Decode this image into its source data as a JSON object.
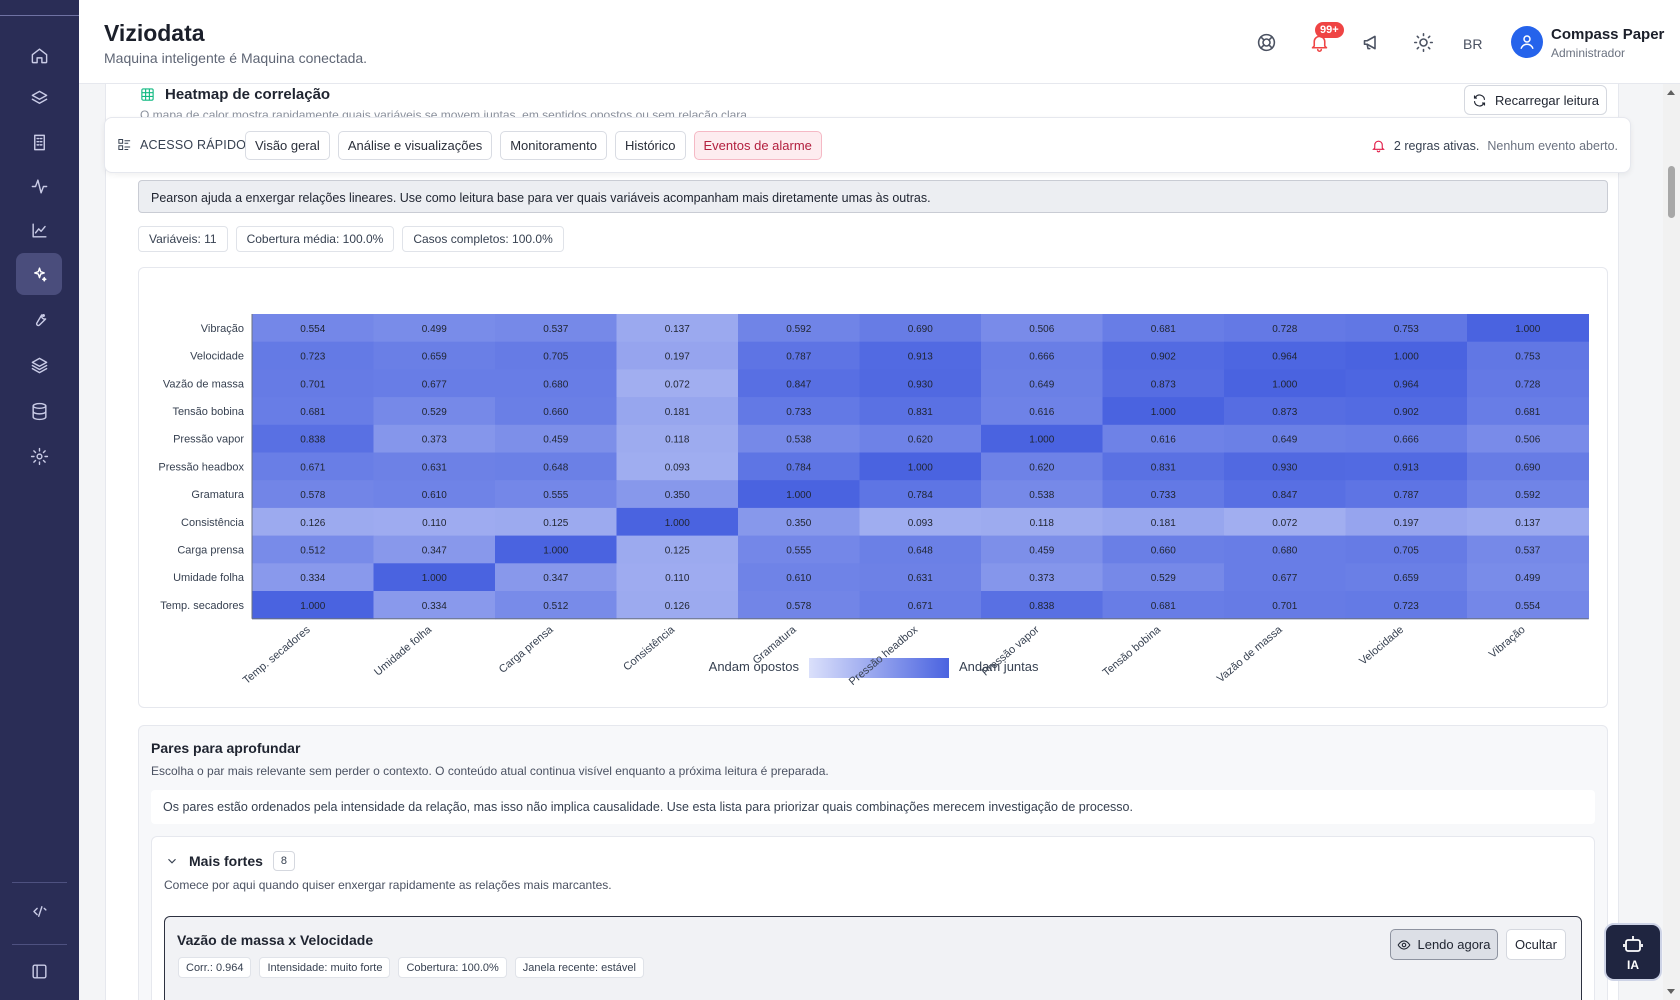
{
  "app": {
    "title": "Viziodata",
    "subtitle": "Maquina inteligente é Maquina conectada."
  },
  "header": {
    "notifications_badge": "99+",
    "language": "BR",
    "user_name": "Compass Paper",
    "user_role": "Administrador"
  },
  "sidebar": {
    "items": [
      "home-icon",
      "layers-icon",
      "building-icon",
      "activity-icon",
      "trend-chart-icon",
      "sparkles-icon",
      "wrench-icon",
      "stack-icon",
      "database-icon",
      "gear-icon"
    ],
    "active_index": 5
  },
  "section": {
    "title": "Heatmap de correlação",
    "description": "O mapa de calor mostra rapidamente quais variáveis se movem juntas, em sentidos opostos ou sem relação clara.",
    "reload_label": "Recarregar leitura"
  },
  "quick_access": {
    "label": "ACESSO RÁPIDO",
    "tabs": [
      "Visão geral",
      "Análise e visualizações",
      "Monitoramento",
      "Histórico",
      "Eventos de alarme"
    ],
    "status_active": "2 regras ativas.",
    "status_events": "Nenhum evento aberto."
  },
  "info_text": "Pearson ajuda a enxergar relações lineares. Use como leitura base para ver quais variáveis acompanham mais diretamente umas às outras.",
  "stats": {
    "variables": "Variáveis: 11",
    "coverage": "Cobertura média: 100.0%",
    "complete": "Casos completos: 100.0%"
  },
  "chart_data": {
    "type": "heatmap",
    "x_labels": [
      "Temp. secadores",
      "Umidade folha",
      "Carga prensa",
      "Consistência",
      "Gramatura",
      "Pressão headbox",
      "Pressão vapor",
      "Tensão bobina",
      "Vazão de massa",
      "Velocidade",
      "Vibração"
    ],
    "y_labels": [
      "Vibração",
      "Velocidade",
      "Vazão de massa",
      "Tensão bobina",
      "Pressão vapor",
      "Pressão headbox",
      "Gramatura",
      "Consistência",
      "Carga prensa",
      "Umidade folha",
      "Temp. secadores"
    ],
    "values": [
      [
        0.554,
        0.499,
        0.537,
        0.137,
        0.592,
        0.69,
        0.506,
        0.681,
        0.728,
        0.753,
        1.0
      ],
      [
        0.723,
        0.659,
        0.705,
        0.197,
        0.787,
        0.913,
        0.666,
        0.902,
        0.964,
        1.0,
        0.753
      ],
      [
        0.701,
        0.677,
        0.68,
        0.072,
        0.847,
        0.93,
        0.649,
        0.873,
        1.0,
        0.964,
        0.728
      ],
      [
        0.681,
        0.529,
        0.66,
        0.181,
        0.733,
        0.831,
        0.616,
        1.0,
        0.873,
        0.902,
        0.681
      ],
      [
        0.838,
        0.373,
        0.459,
        0.118,
        0.538,
        0.62,
        1.0,
        0.616,
        0.649,
        0.666,
        0.506
      ],
      [
        0.671,
        0.631,
        0.648,
        0.093,
        0.784,
        1.0,
        0.62,
        0.831,
        0.93,
        0.913,
        0.69
      ],
      [
        0.578,
        0.61,
        0.555,
        0.35,
        1.0,
        0.784,
        0.538,
        0.733,
        0.847,
        0.787,
        0.592
      ],
      [
        0.126,
        0.11,
        0.125,
        1.0,
        0.35,
        0.093,
        0.118,
        0.181,
        0.072,
        0.197,
        0.137
      ],
      [
        0.512,
        0.347,
        1.0,
        0.125,
        0.555,
        0.648,
        0.459,
        0.66,
        0.68,
        0.705,
        0.537
      ],
      [
        0.334,
        1.0,
        0.347,
        0.11,
        0.61,
        0.631,
        0.373,
        0.529,
        0.677,
        0.659,
        0.499
      ],
      [
        1.0,
        0.334,
        0.512,
        0.126,
        0.578,
        0.671,
        0.838,
        0.681,
        0.701,
        0.723,
        0.554
      ]
    ],
    "color_range": [
      "#dbe0fb",
      "#4a63e0"
    ],
    "legend_low": "Andam opostos",
    "legend_high": "Andam juntas"
  },
  "pairs": {
    "title": "Pares para aprofundar",
    "description": "Escolha o par mais relevante sem perder o contexto. O conteúdo atual continua visível enquanto a próxima leitura é preparada.",
    "note": "Os pares estão ordenados pela intensidade da relação, mas isso não implica causalidade. Use esta lista para priorizar quais combinações merecem investigação de processo.",
    "group_title": "Mais fortes",
    "group_count": "8",
    "group_description": "Comece por aqui quando quiser enxergar rapidamente as relações mais marcantes.",
    "card": {
      "title": "Vazão de massa x Velocidade",
      "chips": [
        "Corr.: 0.964",
        "Intensidade: muito forte",
        "Cobertura: 100.0%",
        "Janela recente: estável"
      ],
      "reading_label": "Lendo agora",
      "hide_label": "Ocultar"
    }
  },
  "assistant": {
    "label": "IA"
  }
}
